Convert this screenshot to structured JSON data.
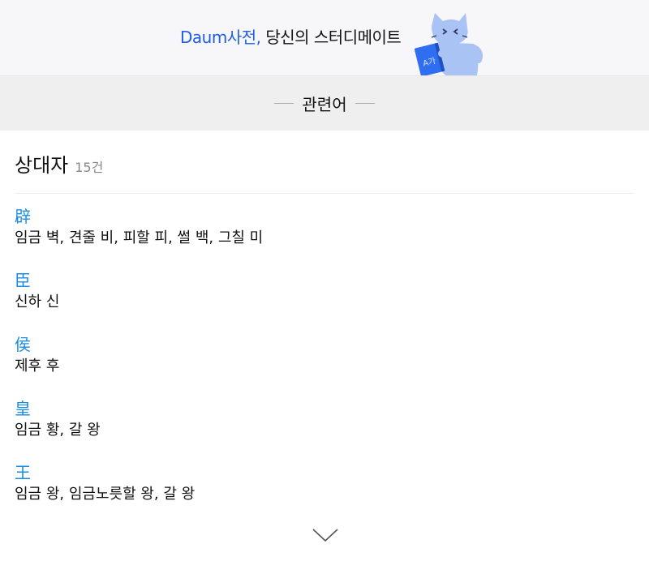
{
  "promo": {
    "brand": "Daum사전,",
    "tagline": " 당신의 스터디메이트",
    "book_label": "A가"
  },
  "related": {
    "title": "관련어"
  },
  "section": {
    "heading": "상대자",
    "count": "15건"
  },
  "entries": [
    {
      "hanja": "辟",
      "meaning": "임금 벽, 견줄 비, 피할 피, 썰 백, 그칠 미"
    },
    {
      "hanja": "臣",
      "meaning": "신하 신"
    },
    {
      "hanja": "侯",
      "meaning": "제후 후"
    },
    {
      "hanja": "皇",
      "meaning": "임금 황, 갈 왕"
    },
    {
      "hanja": "王",
      "meaning": "임금 왕, 임금노릇할 왕, 갈 왕"
    }
  ],
  "colors": {
    "brand": "#1f5de6",
    "hanja_link": "#1a8ce8",
    "bar_bg": "#efefef",
    "promo_bg": "#f7f7f9"
  },
  "icons": {
    "mascot": "cat-mascot-icon",
    "more": "chevron-down-icon"
  }
}
